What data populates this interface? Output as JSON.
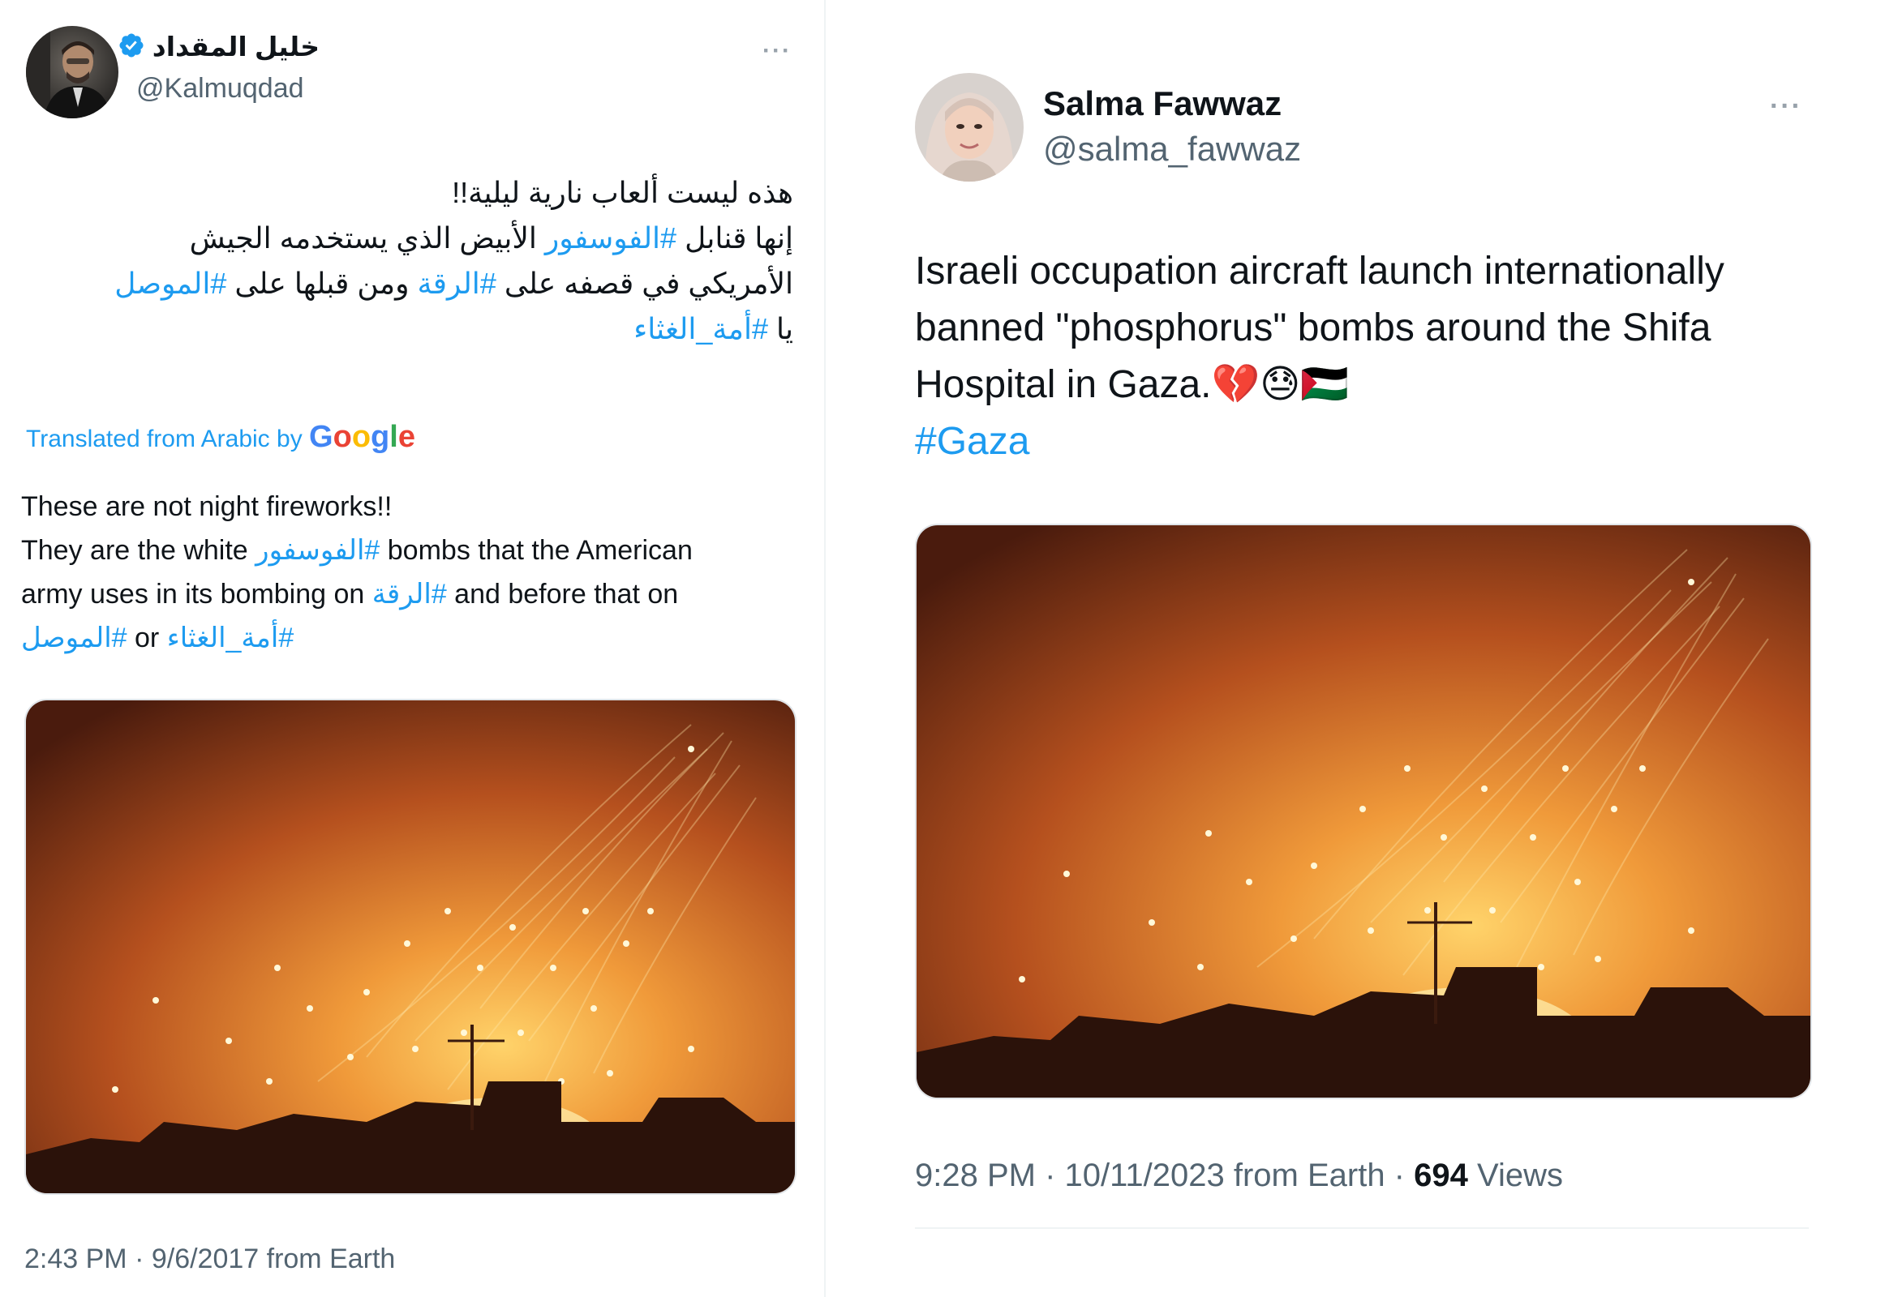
{
  "tweet1": {
    "display_name": "خليل المقداد",
    "handle": "@Kalmuqdad",
    "more_label": "···",
    "arabic_lines": [
      [
        {
          "t": "هذه ليست ألعاب نارية ليلية!!",
          "tag": false
        }
      ],
      [
        {
          "t": "إنها قنابل ",
          "tag": false
        },
        {
          "t": "#الفوسفور",
          "tag": true
        },
        {
          "t": " الأبيض الذي يستخدمه الجيش",
          "tag": false
        }
      ],
      [
        {
          "t": "الأمريكي في قصفه على ",
          "tag": false
        },
        {
          "t": "#الرقة",
          "tag": true
        },
        {
          "t": " ومن قبلها على ",
          "tag": false
        },
        {
          "t": "#الموصل",
          "tag": true
        }
      ],
      [
        {
          "t": "يا ",
          "tag": false
        },
        {
          "t": "#أمة_الغثاء",
          "tag": true
        }
      ]
    ],
    "translated_prefix": "Translated from Arabic by",
    "google_word": "Google",
    "english_lines": [
      [
        {
          "t": "These are not night fireworks!!",
          "tag": false
        }
      ],
      [
        {
          "t": "They are the white ",
          "tag": false
        },
        {
          "t": "الفوسفور#",
          "tag": true
        },
        {
          "t": " bombs that the American",
          "tag": false
        }
      ],
      [
        {
          "t": "army uses in its bombing on ",
          "tag": false
        },
        {
          "t": "الرقة#",
          "tag": true
        },
        {
          "t": " and before that on",
          "tag": false
        }
      ],
      [
        {
          "t": "الموصل#",
          "tag": true
        },
        {
          "t": " or ",
          "tag": false
        },
        {
          "t": "أمة_الغثاء#",
          "tag": true
        }
      ]
    ],
    "timestamp": "2:43 PM · 9/6/2017 from Earth"
  },
  "tweet2": {
    "display_name": "Salma Fawwaz",
    "handle": "@salma_fawwaz",
    "more_label": "···",
    "text_lines": [
      "Israeli occupation aircraft launch internationally",
      "banned \"phosphorus\" bombs around the Shifa",
      "Hospital in Gaza.💔😓🇵🇸"
    ],
    "hashtag": "#Gaza",
    "timestamp": "9:28 PM · 10/11/2023 from Earth · ",
    "views_count": "694",
    "views_label": " Views"
  },
  "colors": {
    "link": "#1d9bf0",
    "secondary_text": "#536471",
    "primary_text": "#0f1419",
    "verified_badge": "#1d9bf0"
  },
  "icons": {
    "verified": "verified-badge-icon",
    "more": "more-horizontal-icon"
  }
}
